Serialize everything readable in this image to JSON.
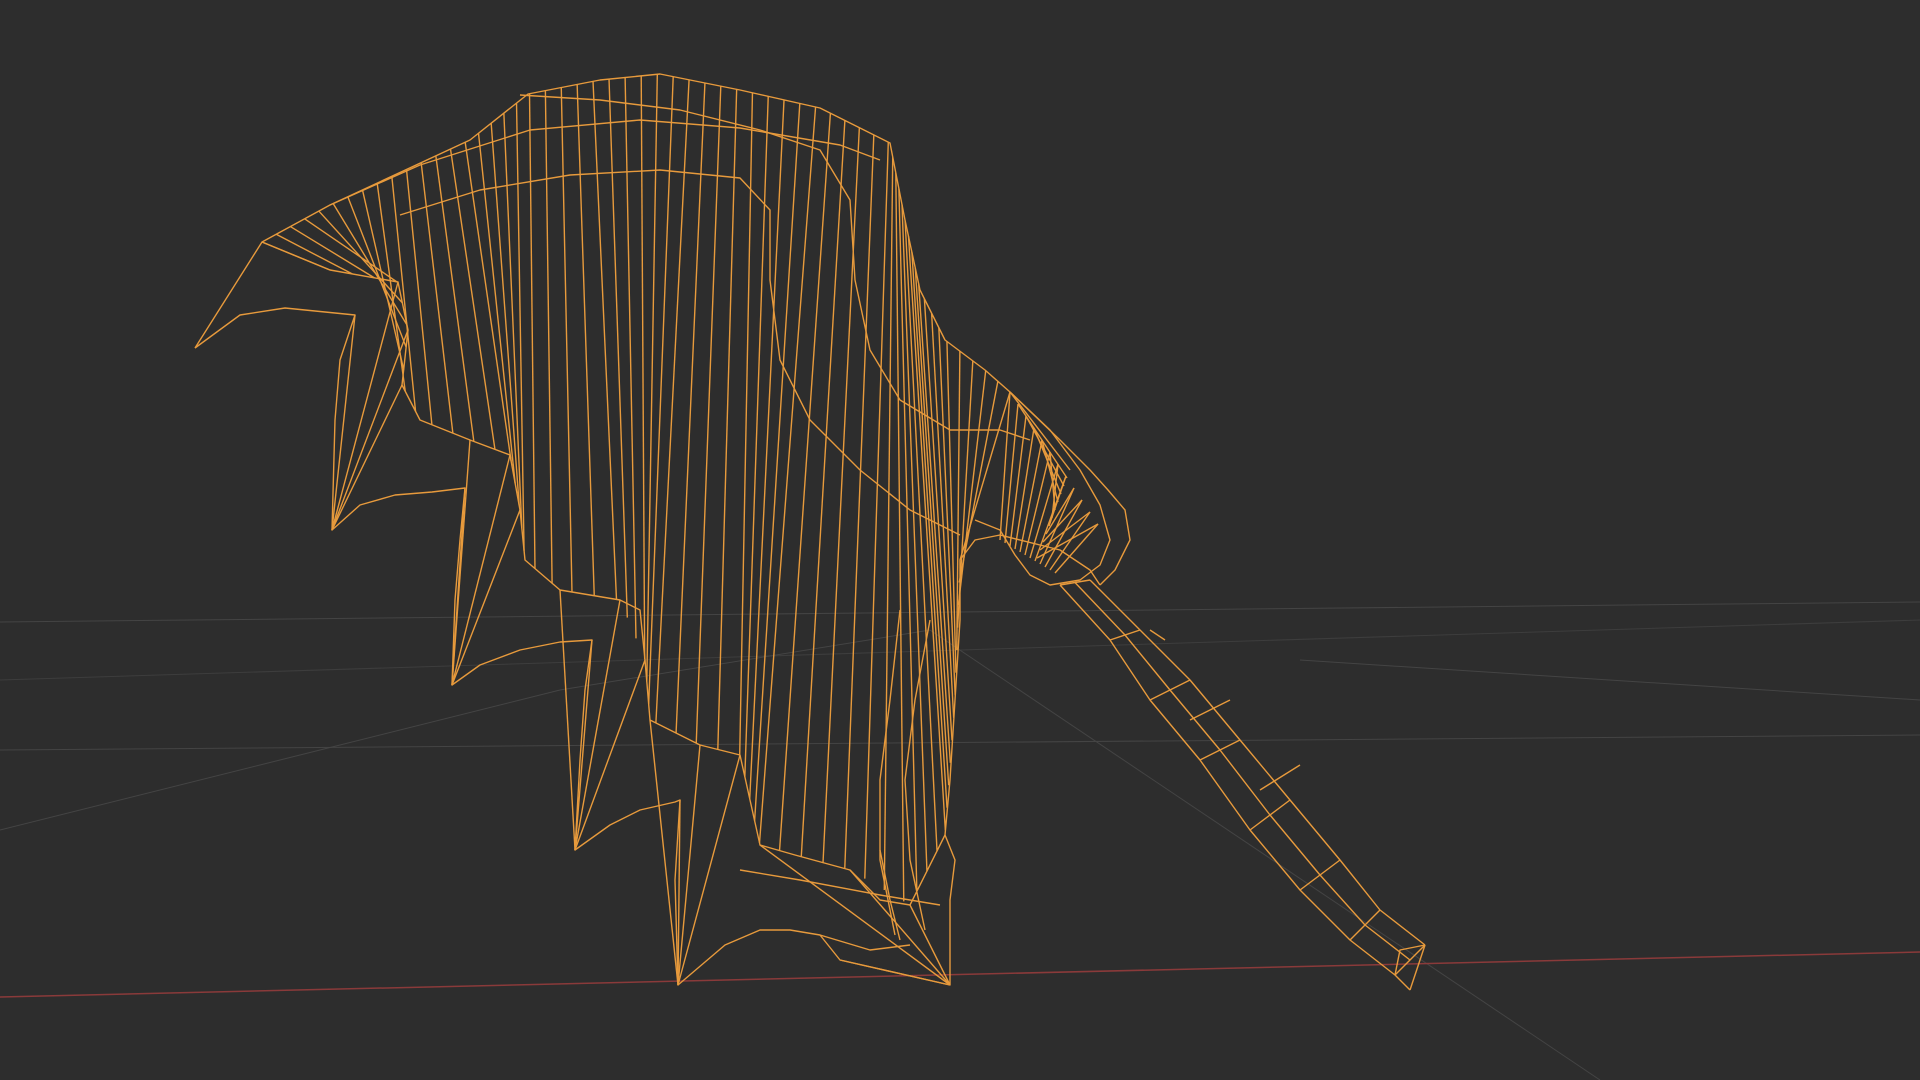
{
  "viewport": {
    "background": "#2d2d2d",
    "wire_color": "#e79a3c",
    "grid_color": "#444444",
    "x_axis_color": "#8a3a3a",
    "mode": "wireframe",
    "selected": true
  },
  "object": {
    "icon": "mesh-wing-icon"
  }
}
